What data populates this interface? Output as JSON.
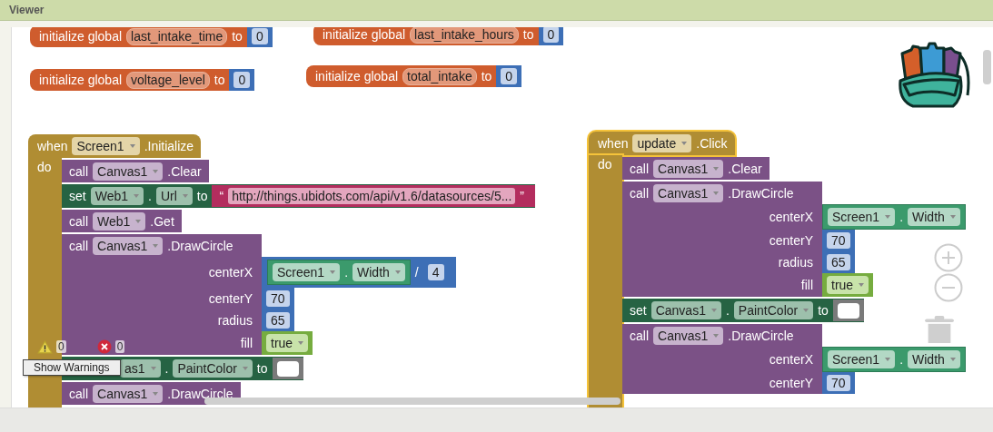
{
  "panel": {
    "title": "Viewer"
  },
  "globals": [
    {
      "label": "initialize global",
      "name": "last_intake_time",
      "to": "to",
      "value": {
        "kind": "number",
        "text": "0"
      }
    },
    {
      "label": "initialize global",
      "name": "last_intake_hours",
      "to": "to",
      "value": {
        "kind": "number",
        "text": "0"
      }
    },
    {
      "label": "initialize global",
      "name": "voltage_level",
      "to": "to",
      "value": {
        "kind": "number",
        "text": "0"
      }
    },
    {
      "label": "initialize global",
      "name": "total_intake",
      "to": "to",
      "value": {
        "kind": "number",
        "text": "0"
      }
    }
  ],
  "events": [
    {
      "when": "when",
      "component": "Screen1",
      "event": ".Initialize",
      "do": "do",
      "selected": false,
      "statements": [
        {
          "kind": "call",
          "keyword": "call",
          "component": "Canvas1",
          "method": ".Clear"
        },
        {
          "kind": "set",
          "keyword": "set",
          "component": "Web1",
          "dot": ".",
          "property": "Url",
          "to": "to",
          "value": {
            "kind": "text",
            "open": "“",
            "text": "http://things.ubidots.com/api/v1.6/datasources/5...",
            "close": "”"
          }
        },
        {
          "kind": "call",
          "keyword": "call",
          "component": "Web1",
          "method": ".Get"
        },
        {
          "kind": "call",
          "keyword": "call",
          "component": "Canvas1",
          "method": ".DrawCircle",
          "args": [
            {
              "name": "centerX",
              "value": {
                "kind": "math",
                "op": "/",
                "left": {
                  "kind": "getter",
                  "component": "Screen1",
                  "dot": ".",
                  "property": "Width"
                },
                "right": {
                  "kind": "number",
                  "text": "4"
                }
              }
            },
            {
              "name": "centerY",
              "value": {
                "kind": "number",
                "text": "70"
              }
            },
            {
              "name": "radius",
              "value": {
                "kind": "number",
                "text": "65"
              }
            },
            {
              "name": "fill",
              "value": {
                "kind": "boolean",
                "text": "true"
              }
            }
          ]
        },
        {
          "kind": "set",
          "component": "as1",
          "dot": ".",
          "property": "PaintColor",
          "to": "to",
          "value": {
            "kind": "color",
            "color": "#ffffff"
          }
        },
        {
          "kind": "call",
          "keyword": "call",
          "component": "Canvas1",
          "method": ".DrawCircle"
        }
      ]
    },
    {
      "when": "when",
      "component": "update",
      "event": ".Click",
      "do": "do",
      "selected": true,
      "statements": [
        {
          "kind": "call",
          "keyword": "call",
          "component": "Canvas1",
          "method": ".Clear"
        },
        {
          "kind": "call",
          "keyword": "call",
          "component": "Canvas1",
          "method": ".DrawCircle",
          "args": [
            {
              "name": "centerX",
              "value": {
                "kind": "getter",
                "component": "Screen1",
                "dot": ".",
                "property": "Width"
              }
            },
            {
              "name": "centerY",
              "value": {
                "kind": "number",
                "text": "70"
              }
            },
            {
              "name": "radius",
              "value": {
                "kind": "number",
                "text": "65"
              }
            },
            {
              "name": "fill",
              "value": {
                "kind": "boolean",
                "text": "true"
              }
            }
          ]
        },
        {
          "kind": "set",
          "keyword": "set",
          "component": "Canvas1",
          "dot": ".",
          "property": "PaintColor",
          "to": "to",
          "value": {
            "kind": "color",
            "color": "#ffffff"
          }
        },
        {
          "kind": "call",
          "keyword": "call",
          "component": "Canvas1",
          "method": ".DrawCircle",
          "args": [
            {
              "name": "centerX",
              "value": {
                "kind": "getter",
                "component": "Screen1",
                "dot": ".",
                "property": "Width"
              }
            },
            {
              "name": "centerY",
              "value": {
                "kind": "number",
                "text": "70"
              }
            }
          ]
        }
      ]
    }
  ],
  "warnings": {
    "warning_count": "0",
    "error_count": "0",
    "button": "Show Warnings"
  }
}
